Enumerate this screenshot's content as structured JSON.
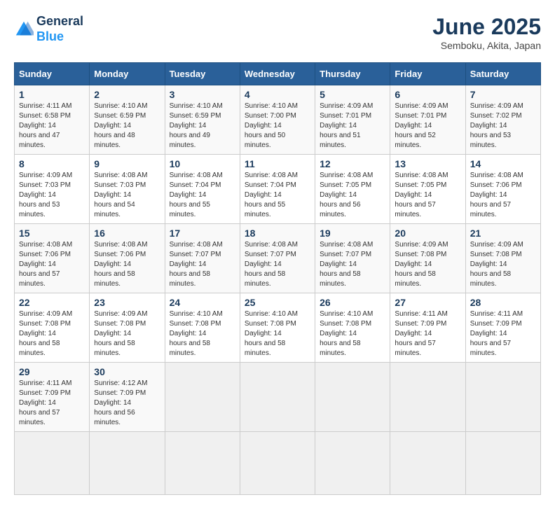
{
  "header": {
    "logo_line1": "General",
    "logo_line2": "Blue",
    "title": "June 2025",
    "subtitle": "Semboku, Akita, Japan"
  },
  "calendar": {
    "weekdays": [
      "Sunday",
      "Monday",
      "Tuesday",
      "Wednesday",
      "Thursday",
      "Friday",
      "Saturday"
    ],
    "weeks": [
      [
        null,
        null,
        null,
        null,
        null,
        null,
        null
      ]
    ],
    "days": [
      {
        "date": 1,
        "sunrise": "4:11 AM",
        "sunset": "6:58 PM",
        "daylight": "14 hours and 47 minutes."
      },
      {
        "date": 2,
        "sunrise": "4:10 AM",
        "sunset": "6:59 PM",
        "daylight": "14 hours and 48 minutes."
      },
      {
        "date": 3,
        "sunrise": "4:10 AM",
        "sunset": "6:59 PM",
        "daylight": "14 hours and 49 minutes."
      },
      {
        "date": 4,
        "sunrise": "4:10 AM",
        "sunset": "7:00 PM",
        "daylight": "14 hours and 50 minutes."
      },
      {
        "date": 5,
        "sunrise": "4:09 AM",
        "sunset": "7:01 PM",
        "daylight": "14 hours and 51 minutes."
      },
      {
        "date": 6,
        "sunrise": "4:09 AM",
        "sunset": "7:01 PM",
        "daylight": "14 hours and 52 minutes."
      },
      {
        "date": 7,
        "sunrise": "4:09 AM",
        "sunset": "7:02 PM",
        "daylight": "14 hours and 53 minutes."
      },
      {
        "date": 8,
        "sunrise": "4:09 AM",
        "sunset": "7:03 PM",
        "daylight": "14 hours and 53 minutes."
      },
      {
        "date": 9,
        "sunrise": "4:08 AM",
        "sunset": "7:03 PM",
        "daylight": "14 hours and 54 minutes."
      },
      {
        "date": 10,
        "sunrise": "4:08 AM",
        "sunset": "7:04 PM",
        "daylight": "14 hours and 55 minutes."
      },
      {
        "date": 11,
        "sunrise": "4:08 AM",
        "sunset": "7:04 PM",
        "daylight": "14 hours and 55 minutes."
      },
      {
        "date": 12,
        "sunrise": "4:08 AM",
        "sunset": "7:05 PM",
        "daylight": "14 hours and 56 minutes."
      },
      {
        "date": 13,
        "sunrise": "4:08 AM",
        "sunset": "7:05 PM",
        "daylight": "14 hours and 57 minutes."
      },
      {
        "date": 14,
        "sunrise": "4:08 AM",
        "sunset": "7:06 PM",
        "daylight": "14 hours and 57 minutes."
      },
      {
        "date": 15,
        "sunrise": "4:08 AM",
        "sunset": "7:06 PM",
        "daylight": "14 hours and 57 minutes."
      },
      {
        "date": 16,
        "sunrise": "4:08 AM",
        "sunset": "7:06 PM",
        "daylight": "14 hours and 58 minutes."
      },
      {
        "date": 17,
        "sunrise": "4:08 AM",
        "sunset": "7:07 PM",
        "daylight": "14 hours and 58 minutes."
      },
      {
        "date": 18,
        "sunrise": "4:08 AM",
        "sunset": "7:07 PM",
        "daylight": "14 hours and 58 minutes."
      },
      {
        "date": 19,
        "sunrise": "4:08 AM",
        "sunset": "7:07 PM",
        "daylight": "14 hours and 58 minutes."
      },
      {
        "date": 20,
        "sunrise": "4:09 AM",
        "sunset": "7:08 PM",
        "daylight": "14 hours and 58 minutes."
      },
      {
        "date": 21,
        "sunrise": "4:09 AM",
        "sunset": "7:08 PM",
        "daylight": "14 hours and 58 minutes."
      },
      {
        "date": 22,
        "sunrise": "4:09 AM",
        "sunset": "7:08 PM",
        "daylight": "14 hours and 58 minutes."
      },
      {
        "date": 23,
        "sunrise": "4:09 AM",
        "sunset": "7:08 PM",
        "daylight": "14 hours and 58 minutes."
      },
      {
        "date": 24,
        "sunrise": "4:10 AM",
        "sunset": "7:08 PM",
        "daylight": "14 hours and 58 minutes."
      },
      {
        "date": 25,
        "sunrise": "4:10 AM",
        "sunset": "7:08 PM",
        "daylight": "14 hours and 58 minutes."
      },
      {
        "date": 26,
        "sunrise": "4:10 AM",
        "sunset": "7:08 PM",
        "daylight": "14 hours and 58 minutes."
      },
      {
        "date": 27,
        "sunrise": "4:11 AM",
        "sunset": "7:09 PM",
        "daylight": "14 hours and 57 minutes."
      },
      {
        "date": 28,
        "sunrise": "4:11 AM",
        "sunset": "7:09 PM",
        "daylight": "14 hours and 57 minutes."
      },
      {
        "date": 29,
        "sunrise": "4:11 AM",
        "sunset": "7:09 PM",
        "daylight": "14 hours and 57 minutes."
      },
      {
        "date": 30,
        "sunrise": "4:12 AM",
        "sunset": "7:09 PM",
        "daylight": "14 hours and 56 minutes."
      }
    ]
  }
}
